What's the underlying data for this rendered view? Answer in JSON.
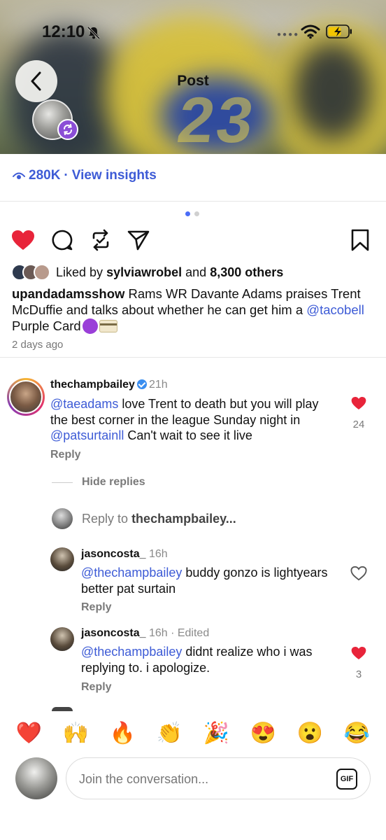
{
  "status_bar": {
    "time": "12:10"
  },
  "header": {
    "title": "Post"
  },
  "insights": {
    "views": "280K",
    "separator": "·",
    "link": "View insights"
  },
  "pager": {
    "pages": 2,
    "current": 1
  },
  "post": {
    "liked_by_prefix": "Liked by",
    "liked_by_user": "sylviawrobel",
    "liked_by_and": "and",
    "liked_by_others": "8,300 others",
    "author": "upandadamsshow",
    "caption_text": "Rams WR Davante Adams praises Trent McDuffie and talks about whether he can get him a",
    "caption_mention": "@tacobell",
    "caption_tail": "Purple Card",
    "date": "2 days ago"
  },
  "comments": [
    {
      "username": "thechampbailey",
      "time": "21h",
      "mention": "@taeadams",
      "text_1": "love Trent to death but you will play the best corner in the league Sunday night in",
      "mention_2": "@patsurtainll",
      "text_2": "Can't wait to see it live",
      "reply_label": "Reply",
      "likes": "24"
    }
  ],
  "replies_controls": {
    "hide_replies": "Hide replies",
    "reply_to_prefix": "Reply to",
    "reply_to_user": "thechampbailey..."
  },
  "replies": [
    {
      "username": "jasoncosta_",
      "meta": "16h",
      "mention": "@thechampbailey",
      "text": "buddy gonzo is lightyears better pat surtain",
      "reply_label": "Reply"
    },
    {
      "username": "jasoncosta_",
      "meta": "16h · Edited",
      "mention": "@thechampbailey",
      "text": "didnt realize who i was replying to. i apologize.",
      "reply_label": "Reply",
      "likes": "3"
    }
  ],
  "emoji_bar": [
    "❤️",
    "🙌",
    "🔥",
    "👏",
    "🎉",
    "😍",
    "😮",
    "😂"
  ],
  "composer": {
    "placeholder": "Join the conversation...",
    "gif_label": "GIF"
  },
  "colors": {
    "link": "#3d5bd6",
    "like_red": "#e8243a",
    "repost_purple": "#8b4ed6"
  }
}
